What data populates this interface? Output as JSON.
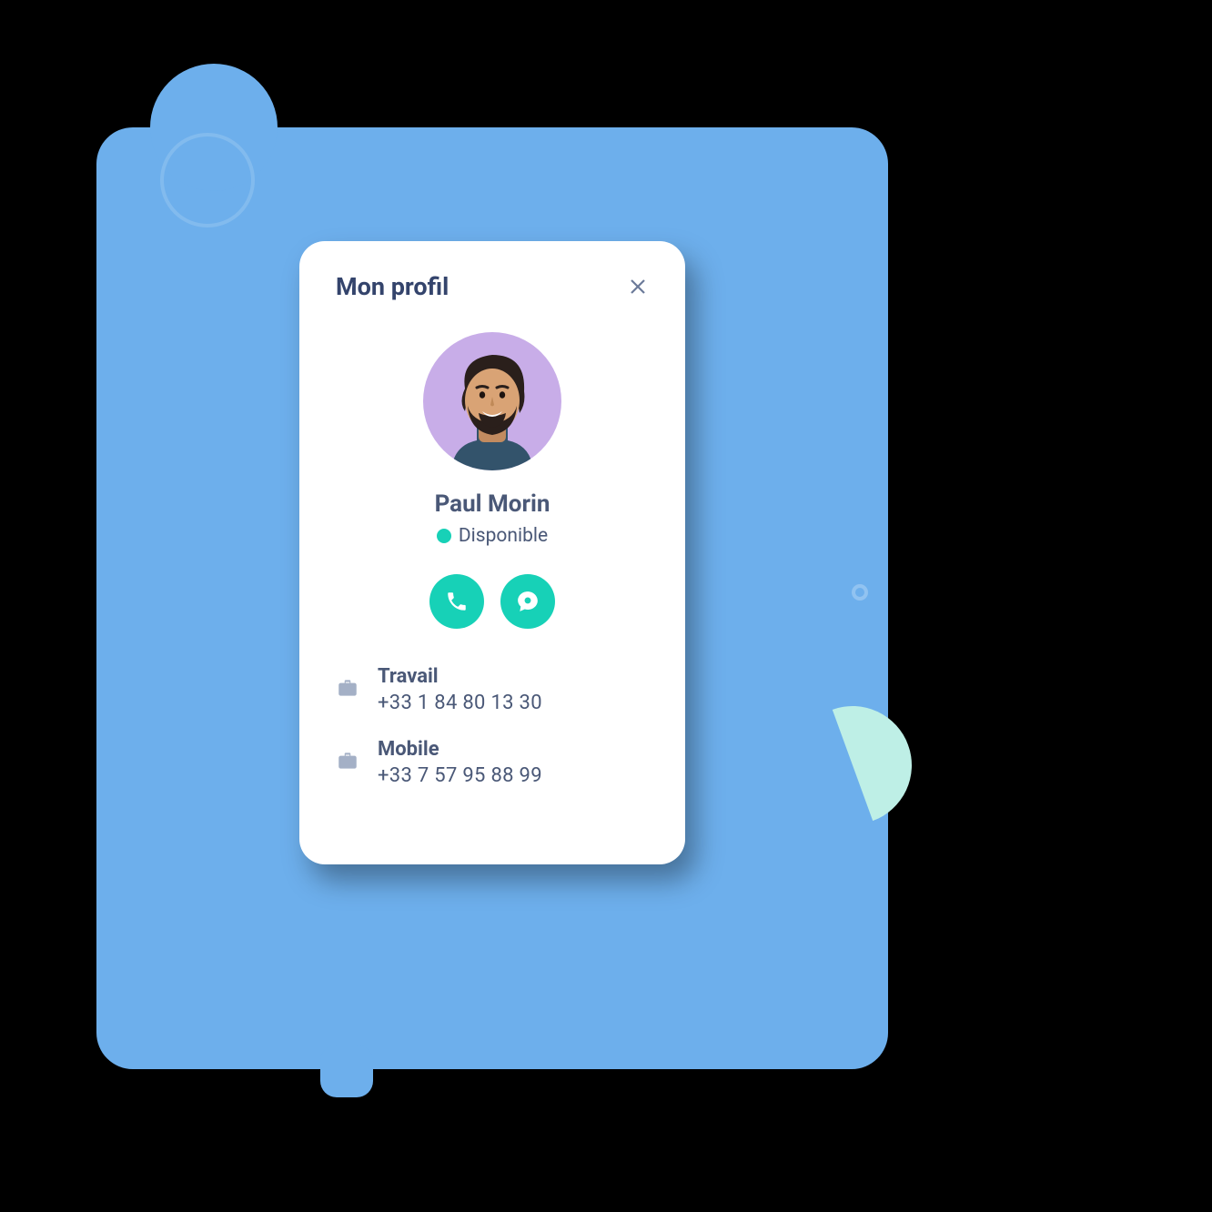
{
  "card": {
    "title": "Mon profil",
    "name": "Paul Morin",
    "status_text": "Disponible",
    "status_color": "#17D1B7",
    "avatar_bg": "#C8ADE8",
    "actions": {
      "call_icon": "phone",
      "chat_icon": "chat"
    },
    "contacts": [
      {
        "label": "Travail",
        "value": "+33 1 84 80 13 30",
        "icon": "briefcase"
      },
      {
        "label": "Mobile",
        "value": "+33 7 57 95 88 99",
        "icon": "briefcase"
      }
    ]
  },
  "colors": {
    "background_blue": "#6DAFEC",
    "accent_teal": "#17D1B7",
    "pale_teal": "#BEEFE6",
    "text_primary": "#34446C",
    "text_secondary": "#4A5877",
    "icon_muted": "#A4B0C6"
  }
}
